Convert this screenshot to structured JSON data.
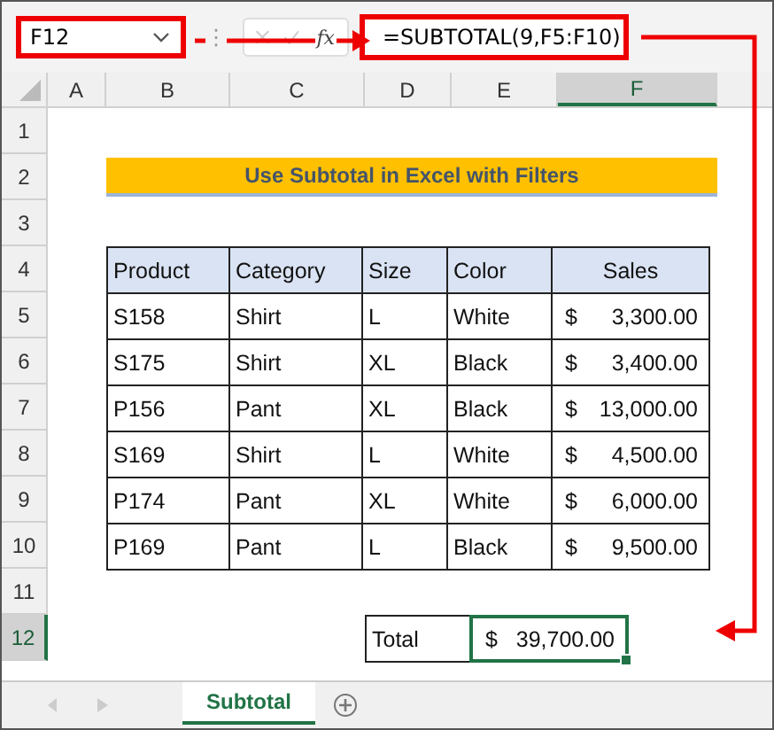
{
  "name_box": {
    "value": "F12"
  },
  "divider_handle": "⋮",
  "formula_bar": {
    "fx": "fx",
    "formula": "=SUBTOTAL(9,F5:F10)"
  },
  "column_headers": [
    {
      "label": "A",
      "selected": false
    },
    {
      "label": "B",
      "selected": false
    },
    {
      "label": "C",
      "selected": false
    },
    {
      "label": "D",
      "selected": false
    },
    {
      "label": "E",
      "selected": false
    },
    {
      "label": "F",
      "selected": true
    }
  ],
  "row_headers": [
    {
      "label": "1",
      "selected": false
    },
    {
      "label": "2",
      "selected": false
    },
    {
      "label": "3",
      "selected": false
    },
    {
      "label": "4",
      "selected": false
    },
    {
      "label": "5",
      "selected": false
    },
    {
      "label": "6",
      "selected": false
    },
    {
      "label": "7",
      "selected": false
    },
    {
      "label": "8",
      "selected": false
    },
    {
      "label": "9",
      "selected": false
    },
    {
      "label": "10",
      "selected": false
    },
    {
      "label": "11",
      "selected": false
    },
    {
      "label": "12",
      "selected": true
    }
  ],
  "title": "Use Subtotal in Excel with Filters",
  "table": {
    "columns": [
      "Product",
      "Category",
      "Size",
      "Color",
      "Sales"
    ],
    "rows": [
      {
        "product": "S158",
        "category": "Shirt",
        "size": "L",
        "color_name": "White",
        "currency": "$",
        "amount": "3,300.00"
      },
      {
        "product": "S175",
        "category": "Shirt",
        "size": "XL",
        "color_name": "Black",
        "currency": "$",
        "amount": "3,400.00"
      },
      {
        "product": "P156",
        "category": "Pant",
        "size": "XL",
        "color_name": "Black",
        "currency": "$",
        "amount": "13,000.00"
      },
      {
        "product": "S169",
        "category": "Shirt",
        "size": "L",
        "color_name": "White",
        "currency": "$",
        "amount": "4,500.00"
      },
      {
        "product": "P174",
        "category": "Pant",
        "size": "XL",
        "color_name": "White",
        "currency": "$",
        "amount": "6,000.00"
      },
      {
        "product": "P169",
        "category": "Pant",
        "size": "L",
        "color_name": "Black",
        "currency": "$",
        "amount": "9,500.00"
      }
    ]
  },
  "total": {
    "label": "Total",
    "currency": "$",
    "amount": "39,700.00",
    "selected": true
  },
  "sheet_tabs": [
    {
      "label": "Subtotal",
      "selected": true
    }
  ]
}
